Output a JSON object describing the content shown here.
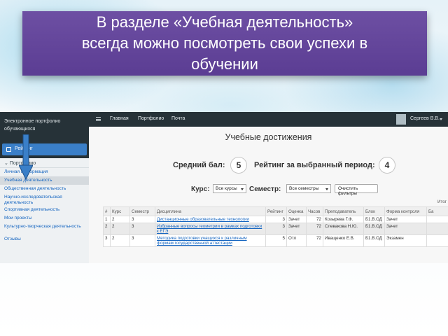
{
  "slide": {
    "title_lines": [
      "В разделе «Учебная деятельность»",
      "всегда можно посмотреть свои успехи в",
      "обучении"
    ],
    "colors": {
      "banner": "#5f4297",
      "sidebar": "#263238",
      "link": "#1565c0",
      "arrow": "#3a7fc8"
    },
    "arrow_icon": "arrow-down-icon"
  },
  "sidebar": {
    "brand_line1": "Электронное портфолио",
    "brand_line2": "обучающихся",
    "search_label": "Рейтинг",
    "section_label": "Портфолио",
    "items": [
      "Личная информация",
      "Учебная деятельность",
      "Общественная деятельность",
      "Научно-исследовательская деятельность",
      "Спортивная деятельность",
      "Мои проекты",
      "Культурно-творческая деятельность",
      "Отзывы"
    ]
  },
  "topbar": {
    "links": [
      "Главная",
      "Портфолио",
      "Почта"
    ],
    "user_name": "Сергеев В.В."
  },
  "main": {
    "title": "Учебные достижения",
    "avg_label": "Средний бал:",
    "avg_value": "5",
    "rating_label": "Рейтинг за выбранный период:",
    "rating_value": "4",
    "course_label": "Курс:",
    "course_select": "Все курсы",
    "semester_label": "Семестр:",
    "semester_select": "Все семестры",
    "clear_button": "Очистить фильтры",
    "itog_label": "Итог"
  },
  "table": {
    "headers": [
      "#",
      "Курс",
      "Семестр",
      "Дисциплина",
      "Рейтинг",
      "Оценка",
      "Часов",
      "Преподаватель",
      "Блок",
      "Форма контроля",
      "Ба"
    ],
    "rows": [
      [
        "1",
        "2",
        "3",
        "Дистанционные образовательные технологии",
        "3",
        "Зачет",
        "72",
        "Козырева Г.Ф.",
        "Б1.В.ОД",
        "Зачет",
        ""
      ],
      [
        "2",
        "2",
        "3",
        "Избранные вопросы геометрии в рамках подготовки к ЕГЭ",
        "3",
        "Зачет",
        "72",
        "Слевакова Н.Ю.",
        "Б1.В.ОД",
        "Зачет",
        ""
      ],
      [
        "3",
        "2",
        "3",
        "Методика подготовки учащихся к различным формам государственной аттестации",
        "5",
        "Отл",
        "72",
        "Иващенко Е.В.",
        "Б1.В.ОД",
        "Экзамен",
        ""
      ]
    ]
  }
}
